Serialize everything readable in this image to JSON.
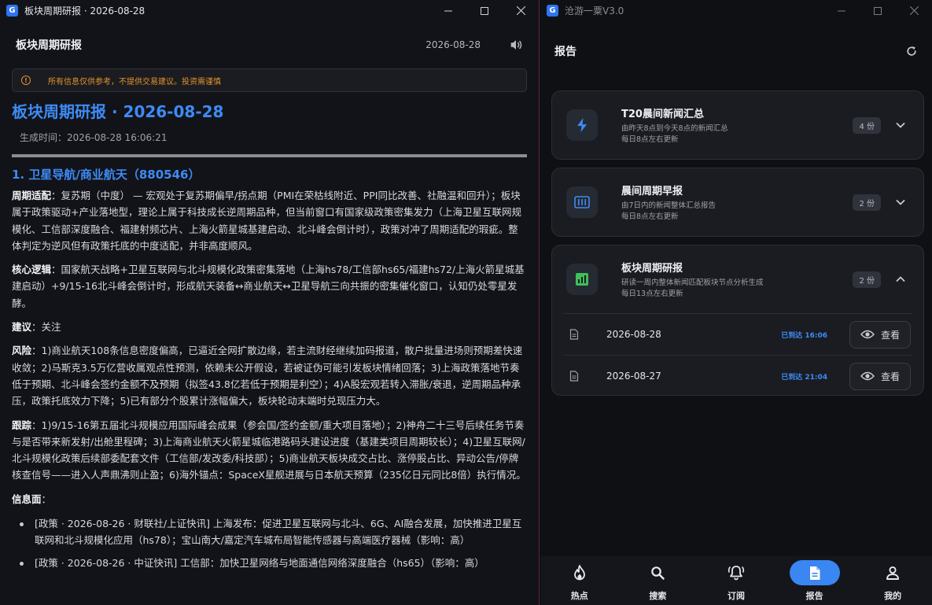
{
  "left_window": {
    "title": "板块周期研报 · 2026-08-28",
    "header": {
      "title": "板块周期研报",
      "date": "2026-08-28"
    },
    "notice": "所有信息仅供参考，不提供交易建议。投资需谨慎",
    "document": {
      "title": "板块周期研报 · 2026-08-28",
      "generated": "生成时间：2026-08-28 16:06:21",
      "section_title": "1. 卫星导航/商业航天（880546）",
      "paragraphs": [
        {
          "label": "周期适配",
          "text": "：复苏期（中度） — 宏观处于复苏期偏早/拐点期（PMI在荣枯线附近、PPI同比改善、社融温和回升）；板块属于政策驱动+产业落地型，理论上属于科技成长逆周期品种，但当前窗口有国家级政策密集发力（上海卫星互联网规模化、工信部深度融合、福建射频芯片、上海火箭星城基建启动、北斗峰会倒计时），政策对冲了周期适配的瑕疵。整体判定为逆风但有政策托底的中度适配，并非高度顺风。"
        },
        {
          "label": "核心逻辑",
          "text": "：国家航天战略+卫星互联网与北斗规模化政策密集落地（上海hs78/工信部hs65/福建hs72/上海火箭星城基建启动）+9/15-16北斗峰会倒计时，形成航天装备↔商业航天↔卫星导航三向共振的密集催化窗口，认知仍处零星发酵。"
        },
        {
          "label": "建议",
          "text": "：关注"
        },
        {
          "label": "风险",
          "text": "：1)商业航天108条信息密度偏高，已逼近全网扩散边缘，若主流财经继续加码报道，散户批量进场则预期差快速收敛；2)马斯克3.5万亿营收属观点性预测，依赖未公开假设，若被证伪可能引发板块情绪回落；3)上海政策落地节奏低于预期、北斗峰会签约金额不及预期（拟签43.8亿若低于预期是利空）；4)A股宏观若转入滞胀/衰退，逆周期品种承压，政策托底效力下降；5)已有部分个股累计涨幅偏大，板块轮动末端时兑现压力大。"
        },
        {
          "label": "跟踪",
          "text": "：1)9/15-16第五届北斗规模应用国际峰会成果（参会国/签约金额/重大项目落地）；2)神舟二十三号后续任务节奏与是否带来新发射/出舱里程碑；3)上海商业航天火箭星城临港路码头建设进度（基建类项目周期较长）；4)卫星互联网/北斗规模化政策后续部委配套文件（工信部/发改委/科技部）；5)商业航天板块成交占比、涨停股占比、异动公告/停牌核查信号——进入人声鼎沸则止盈；6)海外锚点：SpaceX星舰进展与日本航天预算（235亿日元同比8倍）执行情况。"
        },
        {
          "label": "信息面",
          "text": "："
        }
      ],
      "info_items": [
        "[政策 · 2026-08-26 · 财联社/上证快讯] 上海发布：促进卫星互联网与北斗、6G、AI融合发展，加快推进卫星互联网和北斗规模化应用（hs78）；宝山南大/嘉定汽车城布局智能传感器与高端医疗器械（影响：高）",
        "[政策 · 2026-08-26 · 中证快讯] 工信部：加快卫星网络与地面通信网络深度融合（hs65）（影响：高）"
      ]
    }
  },
  "right_window": {
    "title": "沧游一粟V3.0",
    "header_title": "报告",
    "cards": [
      {
        "name": "T20晨间新闻汇总",
        "desc1": "由昨天8点到今天8点的新闻汇总",
        "desc2": "每日8点左右更新",
        "count": "4 份",
        "icon": "bolt-icon"
      },
      {
        "name": "晨间周期早报",
        "desc1": "由7日内的新闻整体汇总报告",
        "desc2": "每日8点左右更新",
        "count": "2 份",
        "icon": "barcode-icon"
      },
      {
        "name": "板块周期研报",
        "desc1": "研读一周内整体新闻匹配板块节点分析生成",
        "desc2": "每日13点左右更新",
        "count": "2 份",
        "icon": "chart-icon"
      }
    ],
    "reports": [
      {
        "date": "2026-08-28",
        "status": "已到达 16:06",
        "view": "查看"
      },
      {
        "date": "2026-08-27",
        "status": "已到达 21:04",
        "view": "查看"
      }
    ],
    "nav": [
      {
        "label": "热点"
      },
      {
        "label": "搜索"
      },
      {
        "label": "订阅"
      },
      {
        "label": "报告"
      },
      {
        "label": "我的"
      }
    ],
    "colors": {
      "accent": "#3a86f2",
      "warning": "#e0932c",
      "chart_green": "#3fbf5a"
    }
  }
}
